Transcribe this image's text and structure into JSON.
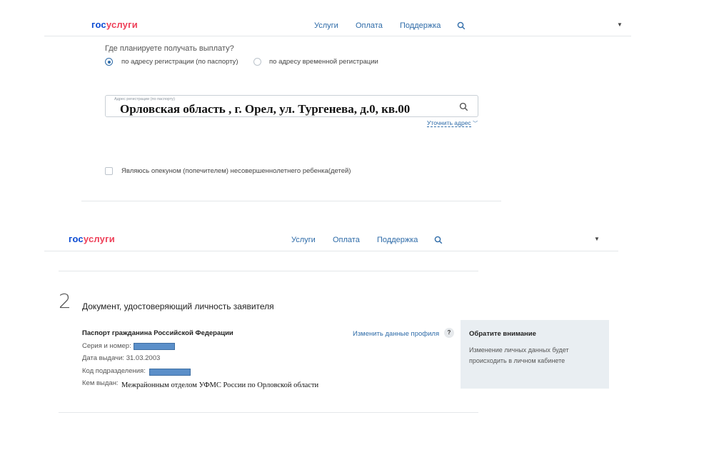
{
  "header1": {
    "logo_gos": "гос",
    "logo_uslugi": "услуги",
    "nav": [
      "Услуги",
      "Оплата",
      "Поддержка"
    ]
  },
  "payment": {
    "question": "Где планируете получать выплату?",
    "options": [
      "по адресу регистрации (по паспорту)",
      "по адресу временной регистрации"
    ],
    "selected_option": 0
  },
  "address": {
    "label": "Адрес регистрации (по паспорту)",
    "value": "Орловская область , г. Орел, ул. Тургенева, д.0, кв.00",
    "refine_link": "Уточнить адрес"
  },
  "guardian": {
    "label": "Являюсь опекуном (попечителем) несовершеннолетнего ребенка(детей)",
    "checked": false
  },
  "header2": {
    "logo_gos": "гос",
    "logo_uslugi": "услуги",
    "nav": [
      "Услуги",
      "Оплата",
      "Поддержка"
    ]
  },
  "document_section": {
    "step_number": "2",
    "title": "Документ, удостоверяющий личность заявителя",
    "doc_type": "Паспорт гражданина Российской Федерации",
    "series_label": "Серия и номер:",
    "issue_date_label": "Дата выдачи:",
    "issue_date": "31.03.2003",
    "division_code_label": "Код подразделения:",
    "issued_by_label": "Кем выдан:",
    "issued_by": "Межрайонным отделом УФМС России по Орловской области",
    "edit_profile_link": "Изменить данные профиля",
    "help": "?"
  },
  "notice": {
    "title": "Обратите внимание",
    "text": "Изменение личных данных будет происходить в личном кабинете"
  },
  "icons": {
    "search": "search-icon",
    "caret": "chevron-down-icon"
  },
  "colors": {
    "brand_blue": "#0d4cd3",
    "brand_red": "#ee3f58",
    "link": "#2e6ba8",
    "notice_bg": "#e9eef2",
    "redaction": "#5b8fc9"
  }
}
